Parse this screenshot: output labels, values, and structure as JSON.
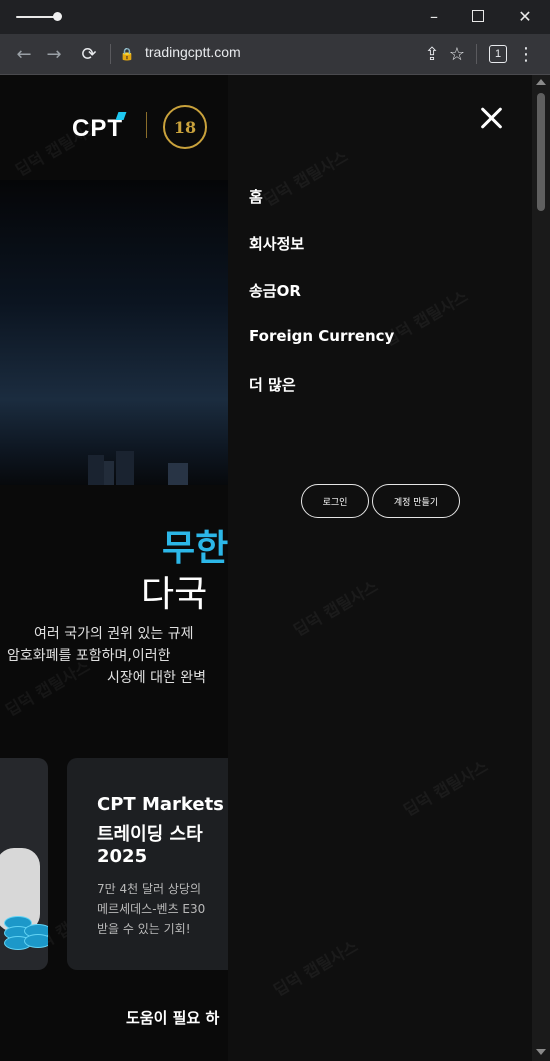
{
  "browser": {
    "url": "tradingcptt.com",
    "tab_count": "1",
    "min_icon": "minimize-icon",
    "max_icon": "maximize-icon",
    "close_icon": "close-icon"
  },
  "site": {
    "logo_text": "CPT",
    "badge_text": "18",
    "hero": {
      "headline_highlight": "무한",
      "headline_main": "다국",
      "body_lines": [
        "여러 국가의 권위 있는 규제",
        "암호화폐를 포함하며,이러한",
        "시장에 대한 완벽"
      ]
    },
    "card": {
      "title_lines": [
        "CPT Markets",
        "트레이딩 스타",
        "2025"
      ],
      "desc_lines": [
        "7만 4천 달러 상당의",
        "메르세데스-벤츠 E30",
        "받을 수 있는 기회!"
      ]
    },
    "help_text": "도움이 필요 하",
    "watermark": "딥덕 캡틸사스"
  },
  "drawer": {
    "menu": [
      {
        "label": "홈"
      },
      {
        "label": "회사정보"
      },
      {
        "label": "송금OR"
      },
      {
        "label": "Foreign Currency"
      },
      {
        "label": "더 많은"
      }
    ],
    "login_label": "로그인",
    "signup_label": "계정 만들기"
  },
  "colors": {
    "accent": "#2cb7e8",
    "badge_gold": "#c9a23c"
  }
}
